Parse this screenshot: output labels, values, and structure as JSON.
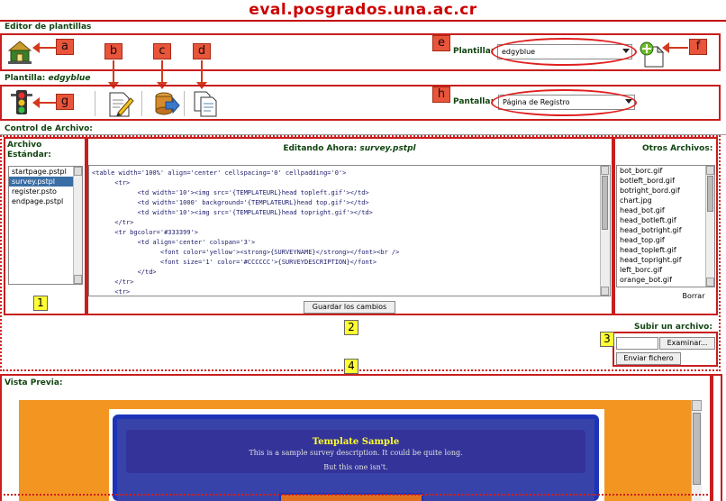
{
  "site": {
    "title": "eval.posgrados.una.ac.cr"
  },
  "editor": {
    "label": "Editor de plantillas",
    "plantilla_label": "Plantilla:",
    "plantilla_value": "edgyblue"
  },
  "plantilla_section": {
    "label_prefix": "Plantilla: ",
    "label_name": "edgyblue",
    "pantalla_label": "Pantalla:",
    "pantalla_value": "Página de Registro"
  },
  "control": {
    "label": "Control de Archivo:",
    "archivo_estandar_label": "Archivo Estándar:",
    "editing_label": "Editando Ahora:",
    "editing_file": "survey.pstpl",
    "otros_label": "Otros Archivos:",
    "standard_files": [
      "startpage.pstpl",
      "survey.pstpl",
      "register.psto",
      "endpage.pstpl"
    ],
    "selected_standard_index": 1,
    "other_files": [
      "bot_borc.gif",
      "botleft_bord.gif",
      "botright_bord.gif",
      "chart.jpg",
      "head_bot.gif",
      "head_botleft.gif",
      "head_botright.gif",
      "head_top.gif",
      "head_topleft.gif",
      "head_topright.gif",
      "left_borc.gif",
      "orange_bot.gif"
    ],
    "code_lines": [
      "<table width='100%' align='center' cellspacing='0' cellpadding='0'>",
      "      <tr>",
      "            <td width='10'><img src='{TEMPLATEURL}head topleft.gif'></td>",
      "            <td width='1000' background='{TEMPLATEURL}head top.gif'></td>",
      "            <td width='10'><img src='{TEMPLATEURL}head topright.gif'></td>",
      "      </tr>",
      "      <tr bgcolor='#333399'>",
      "            <td align='center' colspan='3'>",
      "                  <font color='yellow'><strong>{SURVEYNAME}</strong></font><br />",
      "                  <font size='1' color='#CCCCCC'>{SURVEYDESCRIPTION}</font>",
      "            </td>",
      "      </tr>",
      "      <tr>"
    ],
    "save_button": "Guardar los cambios",
    "delete_button": "Borrar",
    "upload_label": "Subir un archivo:",
    "browse_button": "Examinar...",
    "send_button": "Enviar fichero"
  },
  "preview": {
    "label": "Vista Previa:",
    "template_title": "Template Sample",
    "template_desc": "This is a sample survey description. It could be quite long.",
    "template_desc2": "But this one isn't."
  },
  "annotations": {
    "letters": [
      "a",
      "b",
      "c",
      "d",
      "e",
      "f",
      "g",
      "h"
    ],
    "numbers": [
      "1",
      "2",
      "3",
      "4"
    ]
  }
}
